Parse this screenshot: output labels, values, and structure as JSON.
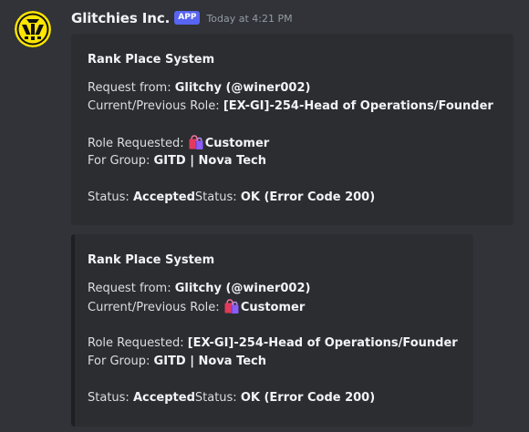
{
  "message": {
    "author": "Glitchies Inc.",
    "badge": "APP",
    "timestamp": "Today at 4:21 PM",
    "avatar_icon": "glitchies-logo-icon"
  },
  "embeds": [
    {
      "title": "Rank Place System",
      "request_from_label": "Request from: ",
      "request_from_value": "Glitchy (@winer002)",
      "current_role_label": "Current/Previous Role: ",
      "current_role_value": "[EX-GI]-254-Head of Operations/Founder",
      "role_requested_label": "Role Requested: ",
      "role_requested_icon": "shopping-bags-emoji",
      "role_requested_value": "Customer",
      "group_label": "For Group: ",
      "group_value": "GITD | Nova Tech",
      "status_label": "Status: ",
      "status_value": "Accepted",
      "status2_label": "Status: ",
      "status2_value": "OK (Error Code 200)"
    },
    {
      "title": "Rank Place System",
      "request_from_label": "Request from: ",
      "request_from_value": "Glitchy (@winer002)",
      "current_role_label": "Current/Previous Role: ",
      "current_role_icon": "shopping-bags-emoji",
      "current_role_value": "Customer",
      "role_requested_label": "Role Requested: ",
      "role_requested_value": "[EX-GI]-254-Head of Operations/Founder",
      "group_label": "For Group: ",
      "group_value": "GITD | Nova Tech",
      "status_label": "Status: ",
      "status_value": "Accepted",
      "status2_label": "Status: ",
      "status2_value": "OK (Error Code 200)"
    }
  ],
  "colors": {
    "background": "#313338",
    "embed_background": "#2b2d31",
    "badge": "#5865f2",
    "avatar_yellow": "#ffe600"
  }
}
